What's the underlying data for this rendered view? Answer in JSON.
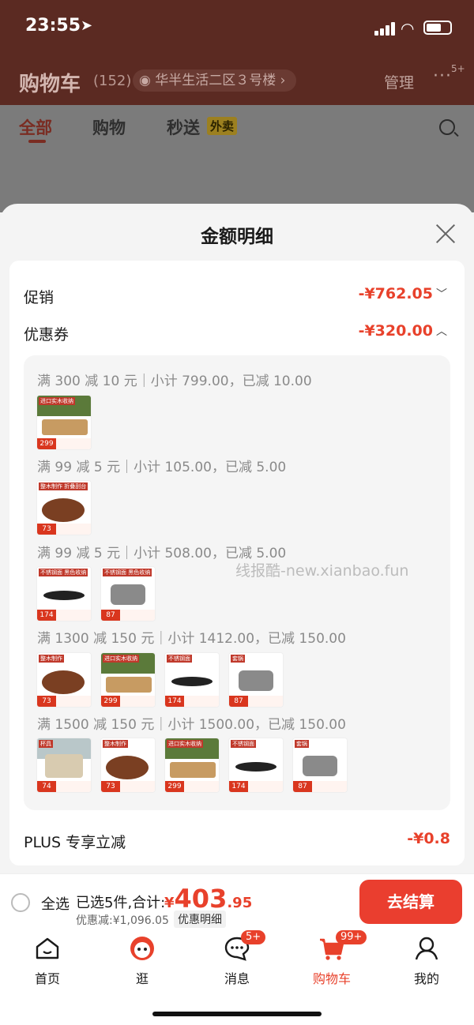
{
  "status": {
    "time": "23:55"
  },
  "header": {
    "title": "购物车",
    "count": "(152)",
    "address": "华半生活二区３号楼",
    "manage": "管理",
    "more_badge": "5+"
  },
  "tabs": [
    {
      "label": "全部"
    },
    {
      "label": "购物"
    },
    {
      "label": "秒送"
    }
  ],
  "tabs_extra": {
    "takeout_tag": "外卖"
  },
  "sheet": {
    "title": "金额明细",
    "rows": [
      {
        "label": "促销",
        "value": "-¥762.05",
        "chevron": "﹀"
      },
      {
        "label": "优惠券",
        "value": "-¥320.00",
        "chevron": "︿"
      }
    ],
    "coupon_groups": [
      {
        "title": "满 300 减 10 元｜小计 799.00，已减 10.00",
        "thumbs": [
          {
            "price": "299",
            "tag": "进口实木收纳"
          }
        ]
      },
      {
        "title": "满 99 减 5 元｜小计 105.00，已减 5.00",
        "thumbs": [
          {
            "price": "73",
            "tag": "整木制作 折叠刮台"
          }
        ]
      },
      {
        "title": "满 99 减 5 元｜小计 508.00，已减 5.00",
        "thumbs": [
          {
            "price": "174",
            "tag": "不锈钢面 黑色收纳"
          },
          {
            "price": "87",
            "tag": "不锈钢面 黑色收纳"
          }
        ]
      },
      {
        "title": "满 1300 减 150 元｜小计 1412.00，已减 150.00",
        "thumbs": [
          {
            "price": "73",
            "tag": "整木制作"
          },
          {
            "price": "299",
            "tag": "进口实木收纳"
          },
          {
            "price": "174",
            "tag": "不锈钢面"
          },
          {
            "price": "87",
            "tag": "套锅"
          }
        ]
      },
      {
        "title": "满 1500 减 150 元｜小计 1500.00，已减 150.00",
        "thumbs": [
          {
            "price": "74",
            "tag": "杯具"
          },
          {
            "price": "73",
            "tag": "整木制作"
          },
          {
            "price": "299",
            "tag": "进口实木收纳"
          },
          {
            "price": "174",
            "tag": "不锈钢面"
          },
          {
            "price": "87",
            "tag": "套锅"
          }
        ]
      }
    ],
    "plus": {
      "label": "PLUS 专享立减",
      "value": "-¥0.8"
    },
    "watermark": "线报酷-new.xianbao.fun"
  },
  "checkout": {
    "select_all": "全选",
    "selected": "已选5件,合计:",
    "currency": "¥",
    "amount_int": "403",
    "amount_dec": ".95",
    "discount": "优惠减:¥1,096.05",
    "detail": "优惠明细",
    "pay": "去结算"
  },
  "nav": [
    {
      "label": "首页",
      "icon": "home-icon"
    },
    {
      "label": "逛",
      "icon": "mascot-icon"
    },
    {
      "label": "消息",
      "icon": "message-icon",
      "badge": "5+"
    },
    {
      "label": "购物车",
      "icon": "cart-icon",
      "badge": "99+",
      "active": true
    },
    {
      "label": "我的",
      "icon": "profile-icon"
    }
  ]
}
